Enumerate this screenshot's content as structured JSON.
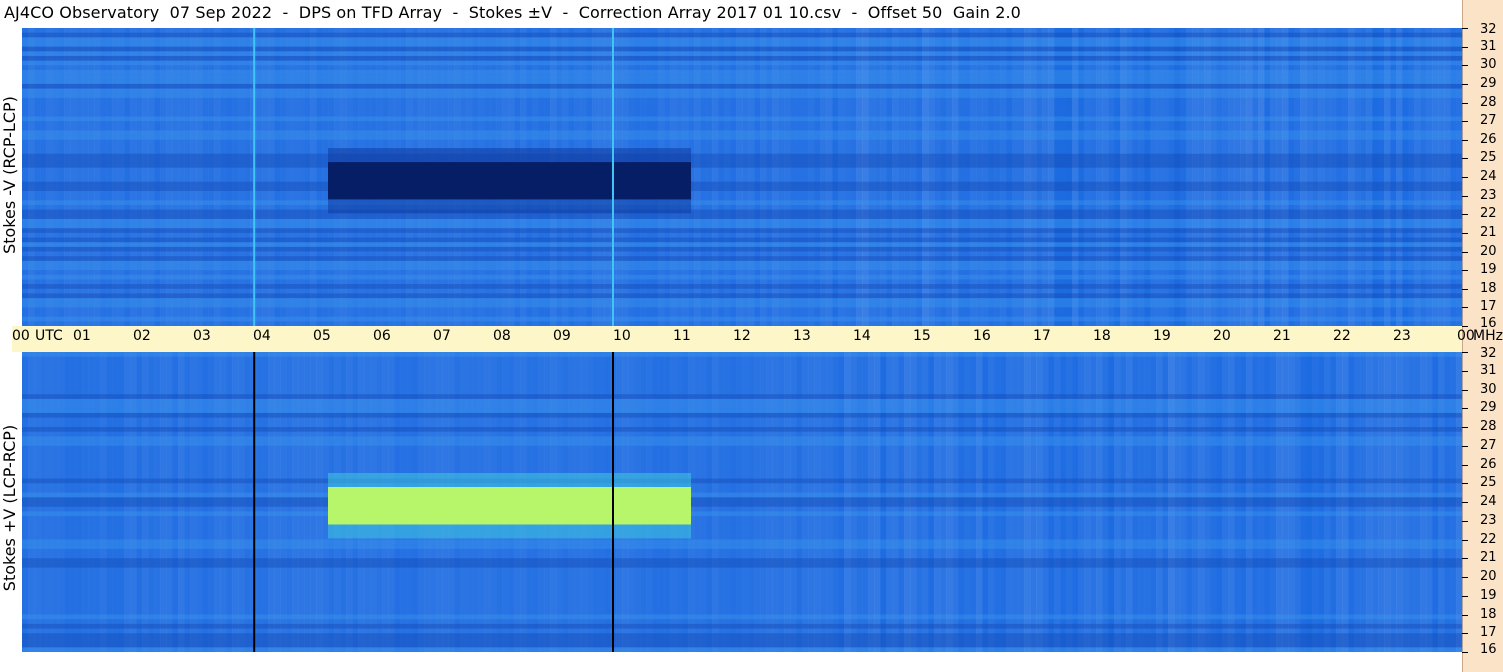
{
  "title": "AJ4CO Observatory  07 Sep 2022  -  DPS on TFD Array  -  Stokes ±V  -  Correction Array 2017 01 10.csv  -  Offset 50  Gain 2.0",
  "colors": {
    "timebar": "#fdf6c8",
    "freqstrip": "#fbe3c8",
    "background_blue": "#1e6ae0"
  },
  "chart_data": [
    {
      "type": "heatmap",
      "title": "",
      "ylabel": "Stokes -V (RCP-LCP)",
      "xlabel": "",
      "x_unit": "UTC",
      "y_unit": "MHz",
      "xlim": [
        0,
        24
      ],
      "ylim": [
        16,
        32
      ],
      "x_ticks": [
        "00",
        "UTC",
        "01",
        "02",
        "03",
        "04",
        "05",
        "06",
        "07",
        "08",
        "09",
        "10",
        "11",
        "12",
        "13",
        "14",
        "15",
        "16",
        "17",
        "18",
        "19",
        "20",
        "21",
        "22",
        "23",
        "00",
        "MHz"
      ],
      "y_ticks": [
        "32",
        "31",
        "30",
        "29",
        "28",
        "27",
        "26",
        "25",
        "24",
        "23",
        "22",
        "21",
        "20",
        "19",
        "18",
        "17",
        "16"
      ],
      "features": [
        {
          "kind": "dark_band",
          "t_start": 5.1,
          "t_end": 11.15,
          "f_low": 22.8,
          "f_high": 24.8
        },
        {
          "kind": "calibration_line",
          "t": 3.87
        },
        {
          "kind": "calibration_line",
          "t": 9.85
        }
      ]
    },
    {
      "type": "heatmap",
      "title": "",
      "ylabel": "Stokes +V (LCP-RCP)",
      "xlabel": "",
      "x_unit": "UTC",
      "y_unit": "MHz",
      "xlim": [
        0,
        24
      ],
      "ylim": [
        16,
        32
      ],
      "x_ticks": [
        "00",
        "UTC",
        "01",
        "02",
        "03",
        "04",
        "05",
        "06",
        "07",
        "08",
        "09",
        "10",
        "11",
        "12",
        "13",
        "14",
        "15",
        "16",
        "17",
        "18",
        "19",
        "20",
        "21",
        "22",
        "23",
        "00",
        "MHz"
      ],
      "y_ticks": [
        "32",
        "31",
        "30",
        "29",
        "28",
        "27",
        "26",
        "25",
        "24",
        "23",
        "22",
        "21",
        "20",
        "19",
        "18",
        "17",
        "16"
      ],
      "features": [
        {
          "kind": "bright_band",
          "t_start": 5.1,
          "t_end": 11.15,
          "f_low": 22.8,
          "f_high": 24.8
        },
        {
          "kind": "calibration_line",
          "t": 3.87
        },
        {
          "kind": "calibration_line",
          "t": 9.85
        }
      ]
    }
  ]
}
